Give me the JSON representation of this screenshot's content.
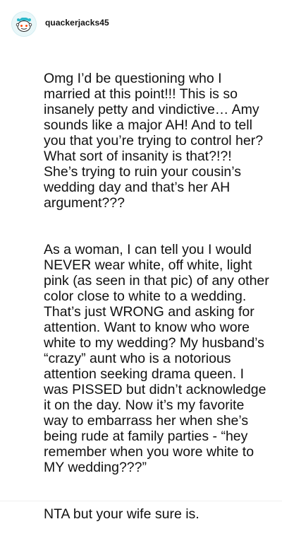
{
  "post": {
    "avatar_icon": "reddit-snoo-avatar-icon",
    "username": "quackerjacks45",
    "paragraphs": [
      "Omg I’d be questioning who I married at this point!!! This is so insanely petty and vindictive… Amy sounds like a major AH! And to tell you that you’re trying to control her? What sort of insanity is that?!?! She’s trying to ruin your cousin’s wedding day and that’s her AH argument???",
      "As a woman, I can tell you I would NEVER wear white, off white, light pink (as seen in that pic) of any other color close to white to a wedding. That’s just WRONG and asking for attention. Want to know who wore white to my wedding? My husband’s “crazy” aunt who is a notorious attention seeking drama queen. I was PISSED but didn’t acknowledge it on the day. Now it’s my favorite way to embarrass her when she’s being rude at family parties - “hey remember when you wore white to MY wedding???”",
      "NTA but your wife sure is."
    ]
  },
  "colors": {
    "avatar_bg": "#e9f7f9",
    "avatar_accent": "#2ab7c9",
    "text": "#111111"
  }
}
